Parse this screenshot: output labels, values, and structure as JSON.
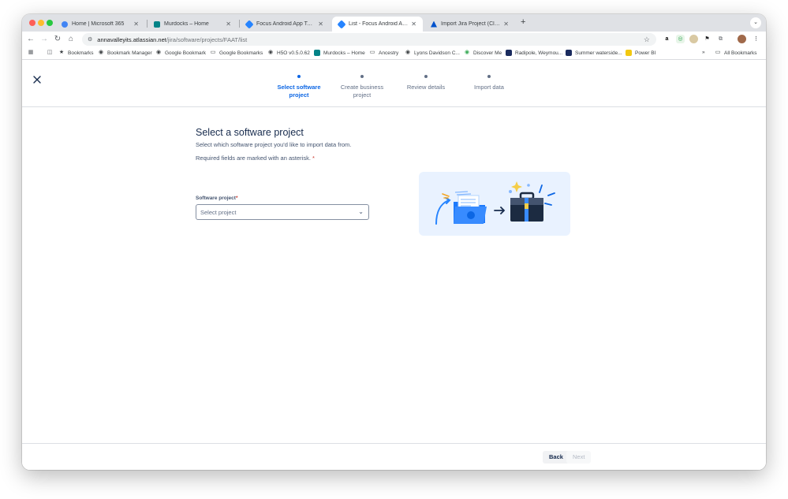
{
  "browser": {
    "tabs": [
      {
        "title": "Home | Microsoft 365",
        "icon": "m365-icon",
        "color": "#4285f4"
      },
      {
        "title": "Murdocks – Home",
        "icon": "sharepoint-icon",
        "color": "#038387"
      },
      {
        "title": "Focus Android App Testing -",
        "icon": "jira-icon",
        "color": "#2684ff"
      },
      {
        "title": "List - Focus Android App Tes",
        "icon": "jira-icon",
        "color": "#2684ff"
      },
      {
        "title": "Import Jira Project (Cloud) P",
        "icon": "atlassian-icon",
        "color": "#0052cc"
      }
    ],
    "active_tab": 3,
    "url_host": "annavalleyits.atlassian.net",
    "url_path": "/jira/software/projects/FAAT/list",
    "bookmarks": [
      {
        "label": "Bookmarks",
        "icon": "star-icon"
      },
      {
        "label": "Bookmark Manager",
        "icon": "globe-icon"
      },
      {
        "label": "Google Bookmark",
        "icon": "globe-icon"
      },
      {
        "label": "Google Bookmarks",
        "icon": "folder-icon"
      },
      {
        "label": "H5O v0.5.0.62",
        "icon": "globe-icon"
      },
      {
        "label": "Murdocks – Home",
        "icon": "sharepoint-icon"
      },
      {
        "label": "Ancestry",
        "icon": "folder-icon"
      },
      {
        "label": "Lyons Davidson C...",
        "icon": "globe-icon"
      },
      {
        "label": "Discover Me",
        "icon": "globe-icon"
      },
      {
        "label": "Radipole, Weymou...",
        "icon": "app-icon"
      },
      {
        "label": "Summer waterside...",
        "icon": "app-icon"
      },
      {
        "label": "Power BI",
        "icon": "powerbi-icon"
      }
    ],
    "more_bookmarks": "»",
    "all_bookmarks": "All Bookmarks"
  },
  "wizard": {
    "steps": [
      {
        "line1": "Select software",
        "line2": "project",
        "active": true
      },
      {
        "line1": "Create business",
        "line2": "project",
        "active": false
      },
      {
        "line1": "Review details",
        "line2": "",
        "active": false
      },
      {
        "line1": "Import data",
        "line2": "",
        "active": false
      }
    ]
  },
  "form": {
    "title": "Select a software project",
    "subtitle": "Select which software project you'd like to import data from.",
    "required_note": "Required fields are marked with an asterisk.",
    "asterisk": "*",
    "field_label": "Software project",
    "select_placeholder": "Select project"
  },
  "footer": {
    "back_label": "Back",
    "next_label": "Next"
  },
  "colors": {
    "accent": "#0c66e4",
    "text": "#172b4d",
    "subtle": "#44546f",
    "illustration_bg": "#e9f2ff"
  }
}
